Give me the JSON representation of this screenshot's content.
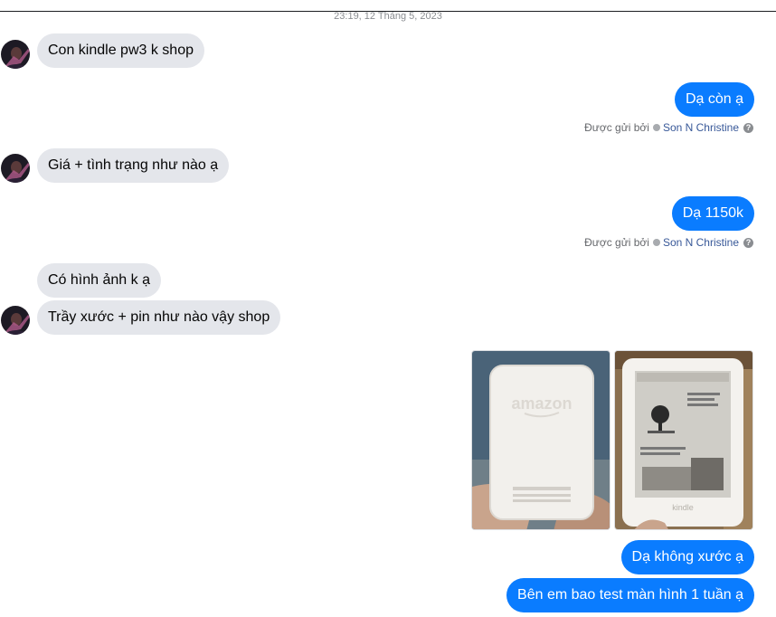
{
  "timestamp": "23:19, 12 Tháng 5, 2023",
  "messages": [
    {
      "text": "Con kindle pw3 k shop"
    },
    {
      "text": "Dạ còn ạ"
    },
    {
      "text": "Giá + tình trạng như nào ạ"
    },
    {
      "text": "Dạ 1150k"
    },
    {
      "text": "Có hình ảnh k ạ"
    },
    {
      "text": "Trầy xước + pin như nào vậy shop"
    },
    {
      "text": "Dạ không xước ạ"
    },
    {
      "text": "Bên em bao test màn hình 1 tuần ạ"
    }
  ],
  "sent_by": {
    "prefix": "Được gửi bởi",
    "name": "Son N Christine",
    "help": "?"
  },
  "photos": [
    {
      "brand_text": "amazon"
    },
    {
      "brand_text": "kindle"
    }
  ],
  "colors": {
    "outgoing_bubble": "#0a7cff",
    "incoming_bubble": "#e4e6eb",
    "sender_name": "#385898"
  }
}
